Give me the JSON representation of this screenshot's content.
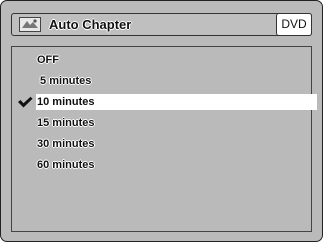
{
  "header": {
    "title": "Auto Chapter",
    "disc_type": "DVD",
    "icon": "chapter-menu-icon"
  },
  "menu": {
    "items": [
      {
        "label": "OFF"
      },
      {
        "label": " 5 minutes"
      },
      {
        "label": "10 minutes",
        "selected": true
      },
      {
        "label": "15 minutes"
      },
      {
        "label": "30 minutes"
      },
      {
        "label": "60 minutes"
      }
    ],
    "selected_index": 2,
    "check_icon": "checkmark-icon"
  },
  "colors": {
    "screen_bg": "#c4c4c4",
    "highlight_bg": "#ffffff",
    "text": "#111111"
  }
}
